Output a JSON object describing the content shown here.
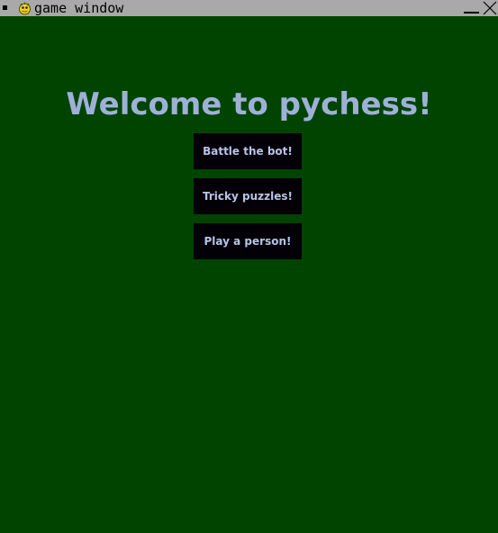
{
  "window": {
    "title": "game window",
    "sys_menu_icon": "square-icon",
    "app_icon": "pygame-snake-icon",
    "minimize_icon": "minimize-icon",
    "close_icon": "close-icon"
  },
  "main": {
    "heading": "Welcome to pychess!",
    "buttons": [
      {
        "label": "Battle the bot!"
      },
      {
        "label": "Tricky puzzles!"
      },
      {
        "label": "Play a person!"
      }
    ]
  },
  "colors": {
    "background": "#004400",
    "titlebar": "#a9a9a9",
    "heading": "#9fb0d8",
    "button_bg": "#030008",
    "button_text": "#b8c3e6"
  }
}
